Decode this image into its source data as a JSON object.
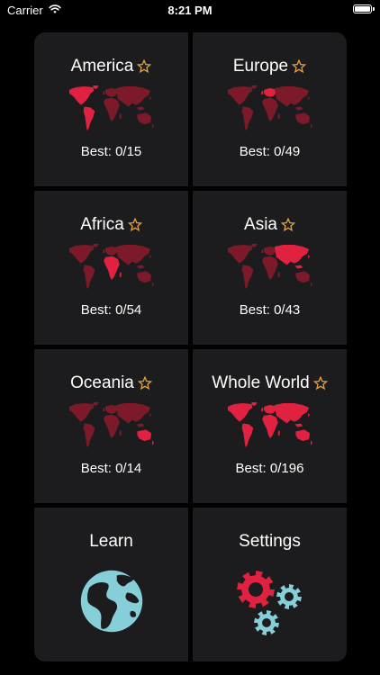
{
  "status_bar": {
    "carrier": "Carrier",
    "time": "8:21 PM"
  },
  "colors": {
    "highlight": "#e02240",
    "dim": "#7d1a2a",
    "star": "#e8a33d",
    "tile_bg": "#1c1c1e",
    "globe": "#86cfd8"
  },
  "tiles": [
    {
      "title": "America",
      "best": "Best: 0/15",
      "highlight_region": "america"
    },
    {
      "title": "Europe",
      "best": "Best: 0/49",
      "highlight_region": "europe"
    },
    {
      "title": "Africa",
      "best": "Best: 0/54",
      "highlight_region": "africa"
    },
    {
      "title": "Asia",
      "best": "Best: 0/43",
      "highlight_region": "asia"
    },
    {
      "title": "Oceania",
      "best": "Best: 0/14",
      "highlight_region": "oceania"
    },
    {
      "title": "Whole World",
      "best": "Best: 0/196",
      "highlight_region": "all"
    }
  ],
  "learn": {
    "title": "Learn",
    "icon": "globe-icon"
  },
  "settings": {
    "title": "Settings",
    "icon": "gears-icon"
  }
}
